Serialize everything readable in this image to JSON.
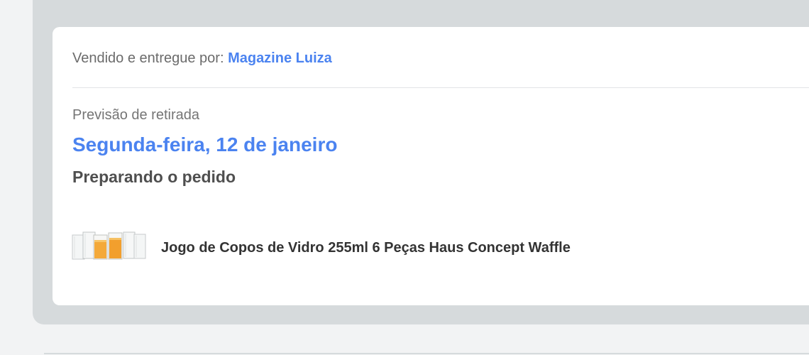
{
  "seller": {
    "prefix": "Vendido e entregue por: ",
    "name": "Magazine Luiza"
  },
  "pickup": {
    "label": "Previsão de retirada",
    "date": "Segunda-feira, 12 de janeiro"
  },
  "order": {
    "status": "Preparando o pedido"
  },
  "product": {
    "name": "Jogo de Copos de Vidro 255ml 6 Peças Haus Concept Waffle"
  },
  "colors": {
    "accent": "#4b83f0",
    "panel": "#d6dadc",
    "card": "#ffffff",
    "page": "#f2f3f4"
  }
}
